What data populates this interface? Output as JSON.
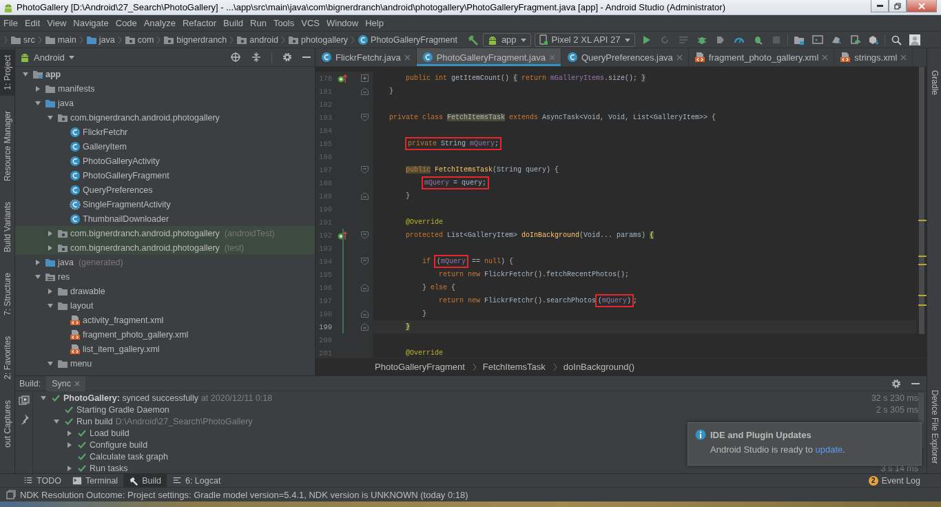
{
  "window": {
    "title": "PhotoGallery [D:\\Android\\27_Search\\PhotoGallery] - ...\\app\\src\\main\\java\\com\\bignerdranch\\android\\photogallery\\PhotoGalleryFragment.java [app] - Android Studio (Administrator)"
  },
  "menu": [
    "File",
    "Edit",
    "View",
    "Navigate",
    "Code",
    "Analyze",
    "Refactor",
    "Build",
    "Run",
    "Tools",
    "VCS",
    "Window",
    "Help"
  ],
  "breadcrumbs": [
    {
      "label": "src",
      "kind": "folder"
    },
    {
      "label": "main",
      "kind": "folder"
    },
    {
      "label": "java",
      "kind": "source"
    },
    {
      "label": "com",
      "kind": "package"
    },
    {
      "label": "bignerdranch",
      "kind": "package"
    },
    {
      "label": "android",
      "kind": "package"
    },
    {
      "label": "photogallery",
      "kind": "package"
    },
    {
      "label": "PhotoGalleryFragment",
      "kind": "class"
    }
  ],
  "toolbar": {
    "module": "app",
    "device": "Pixel 2 XL API 27"
  },
  "left_tool_windows": [
    {
      "label": "1: Project",
      "selected": true
    },
    {
      "label": "Resource Manager",
      "selected": false
    },
    {
      "label": "Build Variants",
      "selected": false
    },
    {
      "label": "7: Structure",
      "selected": false
    },
    {
      "label": "2: Favorites",
      "selected": false
    },
    {
      "label": "out Captures",
      "selected": false
    }
  ],
  "right_tool_windows": [
    {
      "label": "Gradle"
    },
    {
      "label": "Device File Explorer"
    }
  ],
  "project": {
    "view": "Android",
    "tree": [
      {
        "label": "app",
        "kind": "module",
        "expanded": true,
        "children": [
          {
            "label": "manifests",
            "kind": "folder",
            "expanded": false
          },
          {
            "label": "java",
            "kind": "source",
            "expanded": true,
            "children": [
              {
                "label": "com.bignerdranch.android.photogallery",
                "kind": "package",
                "expanded": true,
                "children": [
                  {
                    "label": "FlickrFetchr",
                    "kind": "class"
                  },
                  {
                    "label": "GalleryItem",
                    "kind": "class"
                  },
                  {
                    "label": "PhotoGalleryActivity",
                    "kind": "class"
                  },
                  {
                    "label": "PhotoGalleryFragment",
                    "kind": "class"
                  },
                  {
                    "label": "QueryPreferences",
                    "kind": "class"
                  },
                  {
                    "label": "SingleFragmentActivity",
                    "kind": "abstract-class"
                  },
                  {
                    "label": "ThumbnailDownloader",
                    "kind": "class"
                  }
                ]
              },
              {
                "label": "com.bignerdranch.android.photogallery",
                "suffix": "(androidTest)",
                "kind": "test-package",
                "expanded": false
              },
              {
                "label": "com.bignerdranch.android.photogallery",
                "suffix": "(test)",
                "kind": "test-package",
                "expanded": false
              }
            ]
          },
          {
            "label": "java",
            "suffix": "(generated)",
            "kind": "source",
            "expanded": false
          },
          {
            "label": "res",
            "kind": "res",
            "expanded": true,
            "children": [
              {
                "label": "drawable",
                "kind": "folder",
                "expanded": false
              },
              {
                "label": "layout",
                "kind": "folder",
                "expanded": true,
                "children": [
                  {
                    "label": "activity_fragment.xml",
                    "kind": "xml"
                  },
                  {
                    "label": "fragment_photo_gallery.xml",
                    "kind": "xml"
                  },
                  {
                    "label": "list_item_gallery.xml",
                    "kind": "xml"
                  }
                ]
              },
              {
                "label": "menu",
                "kind": "folder",
                "expanded": true
              }
            ]
          }
        ]
      }
    ]
  },
  "editor": {
    "tabs": [
      {
        "label": "FlickrFetchr.java",
        "kind": "class",
        "selected": false
      },
      {
        "label": "PhotoGalleryFragment.java",
        "kind": "class",
        "selected": true
      },
      {
        "label": "QueryPreferences.java",
        "kind": "class",
        "selected": false
      },
      {
        "label": "fragment_photo_gallery.xml",
        "kind": "xml",
        "selected": false
      },
      {
        "label": "strings.xml",
        "kind": "xml",
        "selected": false
      }
    ],
    "lines": [
      {
        "number": "178",
        "override": true,
        "collapsed": true,
        "tokens": [
          {
            "text": "        public int",
            "kind": "keyword"
          },
          {
            "text": " getItemCount() ",
            "kind": "plain"
          },
          {
            "text": "{",
            "kind": "folded"
          },
          {
            "text": " return ",
            "kind": "keyword"
          },
          {
            "text": "mGalleryItems",
            "kind": "field"
          },
          {
            "text": ".size(); ",
            "kind": "plain"
          },
          {
            "text": "}",
            "kind": "folded"
          }
        ]
      },
      {
        "number": "181",
        "fold_end": true,
        "tokens": [
          {
            "text": "    }",
            "kind": "plain"
          }
        ]
      },
      {
        "number": "182"
      },
      {
        "number": "183",
        "fold_start": true,
        "tokens": [
          {
            "text": "    private class ",
            "kind": "keyword"
          },
          {
            "text": "FetchItemsTask",
            "kind": "plain",
            "highlight": true
          },
          {
            "text": " extends ",
            "kind": "keyword"
          },
          {
            "text": "AsyncTask<Void, Void, List<GalleryItem>> {",
            "kind": "plain"
          }
        ]
      },
      {
        "number": "184"
      },
      {
        "number": "185",
        "tokens": [
          {
            "boxed": true,
            "tokens": [
              {
                "text": "        private",
                "kind": "keyword"
              },
              {
                "text": " String ",
                "kind": "plain"
              },
              {
                "text": "mQuery",
                "kind": "field"
              },
              {
                "text": ";",
                "kind": "plain"
              }
            ]
          }
        ]
      },
      {
        "number": "186"
      },
      {
        "number": "187",
        "fold_start": true,
        "tokens": [
          {
            "text": "        public",
            "kind": "keyword",
            "highlight": true
          },
          {
            "text": " FetchItemsTask",
            "kind": "method"
          },
          {
            "text": "(String query) {",
            "kind": "plain"
          }
        ]
      },
      {
        "number": "188",
        "tokens": [
          {
            "boxed": true,
            "tokens": [
              {
                "text": "            mQuery",
                "kind": "field"
              },
              {
                "text": " = query;",
                "kind": "plain"
              }
            ]
          }
        ]
      },
      {
        "number": "189",
        "fold_end": true,
        "tokens": [
          {
            "text": "        }",
            "kind": "plain"
          }
        ]
      },
      {
        "number": "190"
      },
      {
        "number": "191",
        "tokens": [
          {
            "text": "        @Override",
            "kind": "annotation"
          }
        ]
      },
      {
        "number": "192",
        "override": true,
        "fold_start": true,
        "changed": true,
        "tokens": [
          {
            "text": "        protected",
            "kind": "keyword"
          },
          {
            "text": " List<GalleryItem> ",
            "kind": "plain"
          },
          {
            "text": "doInBackground",
            "kind": "method"
          },
          {
            "text": "(Void... params) ",
            "kind": "plain"
          },
          {
            "text": "{",
            "kind": "brace",
            "highlight": true
          }
        ]
      },
      {
        "number": "193",
        "changed": true
      },
      {
        "number": "194",
        "fold_start": true,
        "changed": true,
        "tokens": [
          {
            "text": "            if ",
            "kind": "keyword"
          },
          {
            "boxed": true,
            "tokens": [
              {
                "text": "(",
                "kind": "plain"
              },
              {
                "text": "mQuery",
                "kind": "field"
              }
            ]
          },
          {
            "text": " == ",
            "kind": "plain"
          },
          {
            "text": "null",
            "kind": "keyword"
          },
          {
            "text": ") {",
            "kind": "plain"
          }
        ]
      },
      {
        "number": "195",
        "changed": true,
        "tokens": [
          {
            "text": "                return new",
            "kind": "keyword"
          },
          {
            "text": " FlickrFetchr().fetchRecentPhotos();",
            "kind": "plain"
          }
        ]
      },
      {
        "number": "196",
        "fold_end": true,
        "changed": true,
        "tokens": [
          {
            "text": "            } ",
            "kind": "plain"
          },
          {
            "text": "else",
            "kind": "keyword"
          },
          {
            "text": " {",
            "kind": "plain"
          }
        ]
      },
      {
        "number": "197",
        "changed": true,
        "tokens": [
          {
            "text": "                return new",
            "kind": "keyword"
          },
          {
            "text": " FlickrFetchr().searchPhotos",
            "kind": "plain"
          },
          {
            "boxed": true,
            "tokens": [
              {
                "text": "(",
                "kind": "plain"
              },
              {
                "text": "mQuery",
                "kind": "field"
              },
              {
                "text": ")",
                "kind": "plain"
              }
            ]
          },
          {
            "text": ";",
            "kind": "plain"
          }
        ]
      },
      {
        "number": "198",
        "fold_end": true,
        "changed": true,
        "tokens": [
          {
            "text": "            }",
            "kind": "plain"
          }
        ]
      },
      {
        "number": "199",
        "fold_end": true,
        "changed": true,
        "current": true,
        "tokens": [
          {
            "text": "        }",
            "kind": "brace",
            "highlight": true
          }
        ]
      },
      {
        "number": "200"
      },
      {
        "number": "201",
        "tokens": [
          {
            "text": "        @Override",
            "kind": "annotation"
          }
        ]
      }
    ],
    "breadcrumbs": [
      "PhotoGalleryFragment",
      "FetchItemsTask",
      "doInBackground()"
    ]
  },
  "build": {
    "title": "Build:",
    "tabs": [
      {
        "label": "Sync",
        "selected": true
      }
    ],
    "tree": [
      {
        "label": "**PhotoGallery:** synced successfully",
        "detail": "at 2020/12/11 0:18",
        "time": "32 s 230 ms",
        "succeeded": true,
        "expanded": true,
        "children": [
          {
            "label": "Starting Gradle Daemon",
            "time": "2 s 305 ms",
            "succeeded": true
          },
          {
            "label": "Run build",
            "detail": "D:\\Android\\27_Search\\PhotoGallery",
            "succeeded": true,
            "expanded": true,
            "children": [
              {
                "label": "Load build",
                "succeeded": true,
                "expanded": false
              },
              {
                "label": "Configure build",
                "succeeded": true,
                "expanded": false
              },
              {
                "label": "Calculate task graph",
                "succeeded": true
              },
              {
                "label": "Run tasks",
                "time": "3 s 14 ms",
                "succeeded": true,
                "expanded": false
              }
            ]
          }
        ]
      }
    ]
  },
  "notification": {
    "title": "IDE and Plugin Updates",
    "message_start": "Android Studio is ready to ",
    "link": "update",
    "message_end": "."
  },
  "tool_tabs": [
    {
      "label": "TODO",
      "kind": "todo",
      "selected": false
    },
    {
      "label": "Terminal",
      "kind": "terminal",
      "selected": false
    },
    {
      "label": "Build",
      "kind": "build",
      "selected": true
    },
    {
      "label": "6: Logcat",
      "kind": "logcat",
      "selected": false
    }
  ],
  "event_log": {
    "label": "Event Log",
    "count": "2"
  },
  "status": "NDK Resolution Outcome: Project settings: Gradle model version=5.4.1, NDK version is UNKNOWN (today 0:18)"
}
